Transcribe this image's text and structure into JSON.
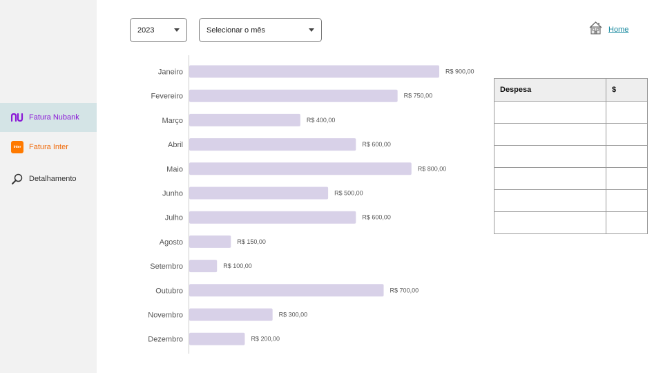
{
  "sidebar": {
    "items": [
      {
        "label": "Fatura Nubank",
        "icon": "nubank-logo-icon",
        "active": true
      },
      {
        "label": "Fatura Inter",
        "icon": "inter-logo-icon"
      },
      {
        "label": "Detalhamento",
        "icon": "magnifier-icon"
      }
    ],
    "inter_badge_text": "inter"
  },
  "filters": {
    "year": "2023",
    "month": "Selecionar o mês"
  },
  "header": {
    "home_label": "Home",
    "home_icon": "house-icon"
  },
  "table": {
    "headers": [
      "Despesa",
      "$"
    ],
    "rows": [
      [
        "",
        ""
      ],
      [
        "",
        ""
      ],
      [
        "",
        ""
      ],
      [
        "",
        ""
      ],
      [
        "",
        ""
      ],
      [
        "",
        ""
      ]
    ]
  },
  "colors": {
    "bar": "#d8d1e8",
    "nubank_purple": "#8a17d6",
    "inter_orange": "#f06a0a",
    "active_bg": "#d4e4e6",
    "link": "#1a8aa0"
  },
  "chart_data": {
    "type": "bar",
    "orientation": "horizontal",
    "categories": [
      "Janeiro",
      "Fevereiro",
      "Março",
      "Abril",
      "Maio",
      "Junho",
      "Julho",
      "Agosto",
      "Setembro",
      "Outubro",
      "Novembro",
      "Dezembro"
    ],
    "values": [
      900,
      750,
      400,
      600,
      800,
      500,
      600,
      150,
      100,
      700,
      300,
      200
    ],
    "data_labels": [
      "R$ 900,00",
      "R$ 750,00",
      "R$ 400,00",
      "R$ 600,00",
      "R$ 800,00",
      "R$ 500,00",
      "R$ 600,00",
      "R$ 150,00",
      "R$ 100,00",
      "R$ 700,00",
      "R$ 300,00",
      "R$ 200,00"
    ],
    "xlim": [
      0,
      900
    ],
    "grid": false
  }
}
